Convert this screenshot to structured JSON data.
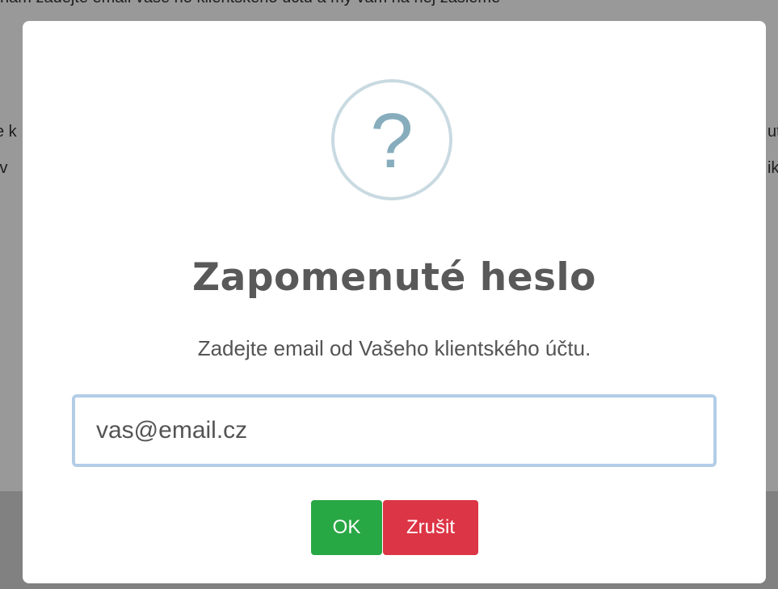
{
  "background": {
    "top_line": "nám zadejte email vaše ho klientského účtu a my vám na něj zašleme",
    "left_fragment_1": "e k",
    "left_fragment_2": "ív",
    "right_fragment_1": "ut",
    "right_fragment_2": "ik"
  },
  "dialog": {
    "icon": "question-mark-icon",
    "icon_glyph": "?",
    "title": "Zapomenuté heslo",
    "text": "Zadejte email od Vašeho klientského účtu.",
    "email_value": "vas@email.cz",
    "ok_label": "OK",
    "cancel_label": "Zrušit"
  },
  "colors": {
    "ok": "#28a745",
    "cancel": "#dc3545",
    "icon_ring": "#c9dae1",
    "icon_glyph": "#87adbd",
    "input_focus_border": "#b3cde6"
  }
}
